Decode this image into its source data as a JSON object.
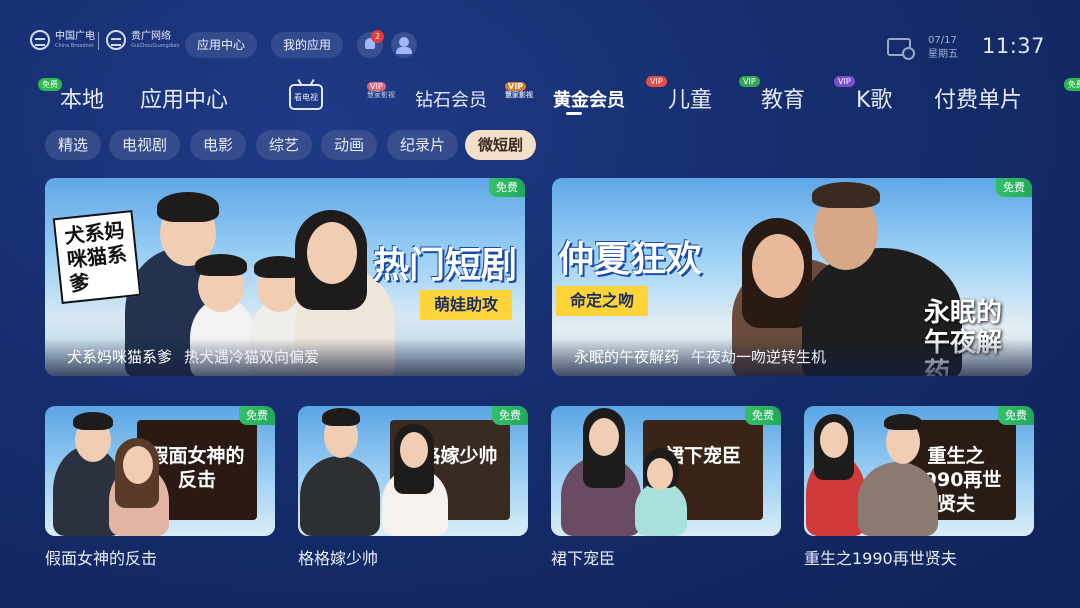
{
  "header": {
    "logos": [
      {
        "main": "中国广电",
        "sub": "China Broadnet"
      },
      {
        "main": "贵广网络",
        "sub": "GuiZhouGuangdian"
      }
    ],
    "app_center_label": "应用中心",
    "my_apps_label": "我的应用",
    "notification_count": "2",
    "date": "07/17",
    "weekday": "星期五",
    "time": "11:37"
  },
  "nav": {
    "items": [
      {
        "label": "本地",
        "tag": "免费"
      },
      {
        "label": "应用中心"
      },
      {
        "label": "看电视"
      },
      {
        "label": "钻石会员",
        "vip": "VIP",
        "vip_sub": "慧家影视"
      },
      {
        "label": "黄金会员",
        "vip": "VIP",
        "vip_sub": "慧家影视"
      },
      {
        "label": "儿童",
        "tag": "VIP"
      },
      {
        "label": "教育",
        "tag": "VIP"
      },
      {
        "label": "K歌",
        "tag": "VIP"
      },
      {
        "label": "付费单片"
      },
      {
        "tag": "免费"
      }
    ]
  },
  "subtabs": [
    "精选",
    "电视剧",
    "电影",
    "综艺",
    "动画",
    "纪录片",
    "微短剧"
  ],
  "banners": [
    {
      "free": "免费",
      "sticker": "犬系妈咪猫系爹",
      "headline": "热门短剧",
      "headline_sub": "萌娃助攻",
      "title": "犬系妈咪猫系爹",
      "subtitle": "热犬遇冷猫双向偏爱"
    },
    {
      "free": "免费",
      "headline": "仲夏狂欢",
      "headline_sub": "命定之吻",
      "calligraphy": "永眠的午夜解药",
      "title": "永眠的午夜解药",
      "subtitle": "午夜劫一吻逆转生机"
    }
  ],
  "cards": [
    {
      "free": "免费",
      "poster_title": "假面女神的反击",
      "label": "假面女神的反击"
    },
    {
      "free": "免费",
      "poster_title": "格格嫁少帅",
      "label": "格格嫁少帅"
    },
    {
      "free": "免费",
      "poster_title": "裙下宠臣",
      "label": "裙下宠臣"
    },
    {
      "free": "免费",
      "poster_title": "重生之1990再世贤夫",
      "label": "重生之1990再世贤夫"
    }
  ],
  "colors": {
    "background": "#162d6e",
    "active_subtab": "#f4dfcb",
    "free_badge": "#1fa958",
    "headline_yellow": "#ffd43b"
  }
}
